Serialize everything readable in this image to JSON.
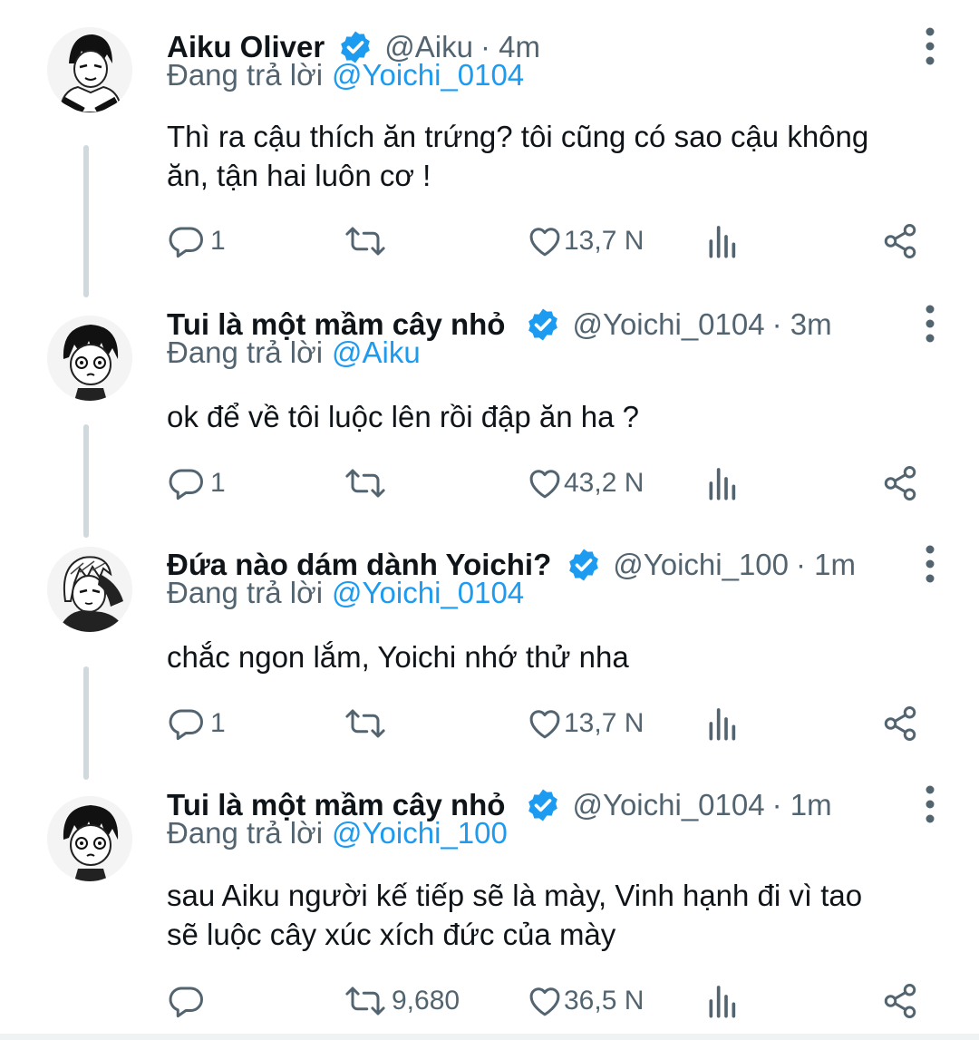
{
  "tweets": [
    {
      "name": "Aiku Oliver",
      "handle": "@Aiku",
      "time": "· 4m",
      "replying_prefix": "Đang trả lời",
      "replying_to": "@Yoichi_0104",
      "text_lines": [
        "Thì ra cậu thích ăn trứng? tôi cũng có sao cậu không",
        "ăn, tận hai luôn cơ !"
      ],
      "replies": "1",
      "retweets": "",
      "likes": "13,7 N"
    },
    {
      "name": "Tui là một mầm cây nhỏ",
      "handle": "@Yoichi_0104",
      "time": "· 3m",
      "replying_prefix": "Đang trả lời",
      "replying_to": "@Aiku",
      "text_lines": [
        "ok để về tôi luộc lên rồi đập ăn ha ?"
      ],
      "replies": "1",
      "retweets": "",
      "likes": "43,2 N"
    },
    {
      "name": "Đứa nào dám dành Yoichi?",
      "handle": "@Yoichi_100",
      "time": "· 1m",
      "replying_prefix": "Đang trả lời",
      "replying_to": "@Yoichi_0104",
      "text_lines": [
        "chắc ngon lắm, Yoichi nhớ thử nha"
      ],
      "replies": "1",
      "retweets": "",
      "likes": "13,7 N"
    },
    {
      "name": "Tui là một mầm cây nhỏ",
      "handle": "@Yoichi_0104",
      "time": "· 1m",
      "replying_prefix": "Đang trả lời",
      "replying_to": "@Yoichi_100",
      "text_lines": [
        "sau Aiku người kế tiếp sẽ là mày, Vinh hạnh đi vì tao",
        "sẽ luộc cây xúc xích đức của mày"
      ],
      "replies": "",
      "retweets": "9,680",
      "likes": "36,5 N"
    }
  ],
  "colors": {
    "accent": "#1d9bf0",
    "muted": "#536471",
    "text": "#0f1419",
    "thread_line": "#cfd9de"
  },
  "icons": [
    "verified-badge-icon",
    "more-icon",
    "reply-icon",
    "retweet-icon",
    "like-icon",
    "views-icon",
    "share-icon"
  ]
}
